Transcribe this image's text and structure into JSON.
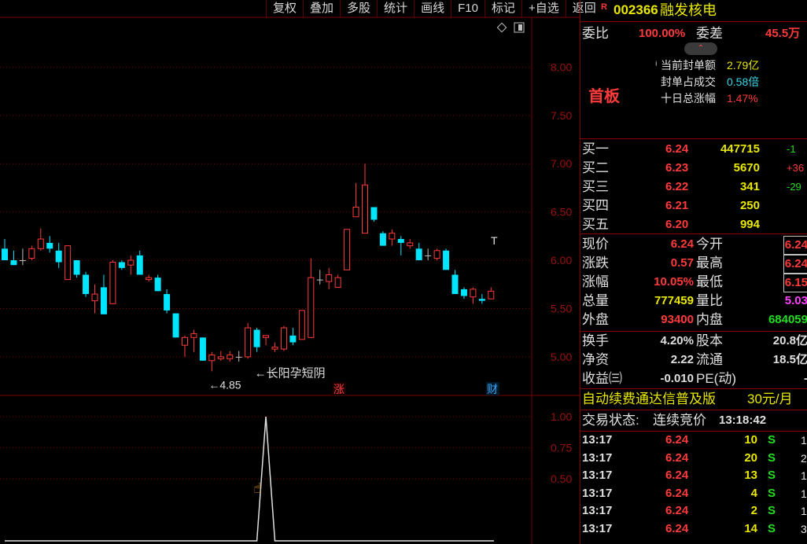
{
  "toolbar": [
    "复权",
    "叠加",
    "多股",
    "统计",
    "画线",
    "F10",
    "标记",
    "+自选",
    "返回"
  ],
  "chart": {
    "price_ticks": [
      "8.00",
      "7.50",
      "7.00",
      "6.50",
      "6.00",
      "5.50",
      "5.00"
    ],
    "indicator_ticks": [
      "1.00",
      "0.75",
      "0.50"
    ],
    "low_label": "←4.85",
    "pattern_label": "←长阳孕短阴",
    "t_marker": "T",
    "zhang_badge": "涨",
    "cai_badge": "财",
    "colors": {
      "up": "#ff3a3a",
      "down": "#00e5ff",
      "doji": "#c0c0c0",
      "grid": "#7a0000"
    }
  },
  "chart_data": {
    "type": "candlestick",
    "price_axis": {
      "min": 4.6,
      "max": 8.5,
      "ticks": [
        8.0,
        7.5,
        7.0,
        6.5,
        6.0,
        5.5,
        5.0
      ]
    },
    "indicator_axis": {
      "min": 0,
      "max": 1.0,
      "ticks": [
        1.0,
        0.75,
        0.5
      ]
    },
    "candles": [
      {
        "o": 6.12,
        "h": 6.22,
        "l": 6.0,
        "c": 6.0
      },
      {
        "o": 6.0,
        "h": 6.1,
        "l": 5.95,
        "c": 5.95
      },
      {
        "o": 6.0,
        "h": 6.12,
        "l": 5.95,
        "c": 6.0
      },
      {
        "o": 6.02,
        "h": 6.15,
        "l": 6.0,
        "c": 6.12
      },
      {
        "o": 6.12,
        "h": 6.33,
        "l": 6.1,
        "c": 6.22
      },
      {
        "o": 6.18,
        "h": 6.25,
        "l": 6.08,
        "c": 6.12
      },
      {
        "o": 6.1,
        "h": 6.18,
        "l": 5.92,
        "c": 5.98
      },
      {
        "o": 5.8,
        "h": 6.1,
        "l": 5.8,
        "c": 6.15
      },
      {
        "o": 6.0,
        "h": 6.0,
        "l": 5.82,
        "c": 5.85
      },
      {
        "o": 5.85,
        "h": 5.88,
        "l": 5.62,
        "c": 5.65
      },
      {
        "o": 5.58,
        "h": 5.75,
        "l": 5.45,
        "c": 5.65
      },
      {
        "o": 5.72,
        "h": 5.85,
        "l": 5.44,
        "c": 5.44
      },
      {
        "o": 5.55,
        "h": 6.0,
        "l": 5.55,
        "c": 5.98
      },
      {
        "o": 5.98,
        "h": 6.0,
        "l": 5.9,
        "c": 5.92
      },
      {
        "o": 5.95,
        "h": 6.05,
        "l": 5.85,
        "c": 6.0
      },
      {
        "o": 6.05,
        "h": 6.1,
        "l": 5.85,
        "c": 5.85
      },
      {
        "o": 5.8,
        "h": 5.85,
        "l": 5.78,
        "c": 5.82
      },
      {
        "o": 5.82,
        "h": 5.85,
        "l": 5.68,
        "c": 5.68
      },
      {
        "o": 5.65,
        "h": 5.7,
        "l": 5.45,
        "c": 5.48
      },
      {
        "o": 5.45,
        "h": 5.45,
        "l": 5.2,
        "c": 5.2
      },
      {
        "o": 5.12,
        "h": 5.22,
        "l": 5.0,
        "c": 5.2
      },
      {
        "o": 5.2,
        "h": 5.28,
        "l": 5.05,
        "c": 5.24
      },
      {
        "o": 5.2,
        "h": 5.2,
        "l": 4.96,
        "c": 4.96
      },
      {
        "o": 4.96,
        "h": 5.05,
        "l": 4.85,
        "c": 5.02
      },
      {
        "o": 4.98,
        "h": 5.06,
        "l": 4.96,
        "c": 5.0
      },
      {
        "o": 4.98,
        "h": 5.06,
        "l": 4.95,
        "c": 5.02
      },
      {
        "o": 5.0,
        "h": 5.06,
        "l": 4.95,
        "c": 5.0
      },
      {
        "o": 5.0,
        "h": 5.35,
        "l": 4.98,
        "c": 5.3
      },
      {
        "o": 5.28,
        "h": 5.3,
        "l": 5.05,
        "c": 5.1
      },
      {
        "o": 5.2,
        "h": 5.22,
        "l": 5.12,
        "c": 5.22
      },
      {
        "o": 5.08,
        "h": 5.15,
        "l": 5.05,
        "c": 5.1
      },
      {
        "o": 5.08,
        "h": 5.32,
        "l": 5.06,
        "c": 5.3
      },
      {
        "o": 5.22,
        "h": 5.3,
        "l": 5.12,
        "c": 5.15
      },
      {
        "o": 5.18,
        "h": 5.48,
        "l": 5.18,
        "c": 5.48
      },
      {
        "o": 5.2,
        "h": 6.02,
        "l": 5.2,
        "c": 5.82
      },
      {
        "o": 5.8,
        "h": 5.9,
        "l": 5.75,
        "c": 5.8
      },
      {
        "o": 5.78,
        "h": 5.92,
        "l": 5.7,
        "c": 5.85
      },
      {
        "o": 5.72,
        "h": 5.85,
        "l": 5.72,
        "c": 5.82
      },
      {
        "o": 5.9,
        "h": 6.32,
        "l": 5.9,
        "c": 6.32
      },
      {
        "o": 6.45,
        "h": 6.8,
        "l": 6.45,
        "c": 6.55
      },
      {
        "o": 6.28,
        "h": 7.0,
        "l": 6.28,
        "c": 6.78
      },
      {
        "o": 6.55,
        "h": 6.55,
        "l": 6.4,
        "c": 6.42
      },
      {
        "o": 6.28,
        "h": 6.3,
        "l": 6.15,
        "c": 6.15
      },
      {
        "o": 6.22,
        "h": 6.32,
        "l": 6.15,
        "c": 6.28
      },
      {
        "o": 6.22,
        "h": 6.25,
        "l": 6.05,
        "c": 6.18
      },
      {
        "o": 6.15,
        "h": 6.22,
        "l": 6.12,
        "c": 6.18
      },
      {
        "o": 6.12,
        "h": 6.18,
        "l": 6.0,
        "c": 6.0
      },
      {
        "o": 6.05,
        "h": 6.12,
        "l": 6.0,
        "c": 6.05
      },
      {
        "o": 6.02,
        "h": 6.12,
        "l": 6.0,
        "c": 6.1
      },
      {
        "o": 6.1,
        "h": 6.12,
        "l": 5.9,
        "c": 5.9
      },
      {
        "o": 5.85,
        "h": 5.9,
        "l": 5.65,
        "c": 5.65
      },
      {
        "o": 5.7,
        "h": 5.72,
        "l": 5.6,
        "c": 5.63
      },
      {
        "o": 5.62,
        "h": 5.72,
        "l": 5.55,
        "c": 5.7
      },
      {
        "o": 5.6,
        "h": 5.65,
        "l": 5.55,
        "c": 5.58
      },
      {
        "o": 5.6,
        "h": 5.72,
        "l": 5.6,
        "c": 5.68
      }
    ],
    "indicator": [
      0,
      0,
      0,
      0,
      0,
      0,
      0,
      0,
      0,
      0,
      0,
      0,
      0,
      0,
      0,
      0,
      0,
      0,
      0,
      0,
      0,
      0,
      0,
      0,
      0,
      0,
      0,
      0,
      0,
      1,
      0,
      0,
      0,
      0,
      0,
      0,
      0,
      0,
      0,
      0,
      0,
      0,
      0,
      0,
      0,
      0,
      0,
      0,
      0,
      0,
      0,
      0,
      0,
      0,
      0
    ]
  },
  "quote": {
    "flag": "R",
    "code": "002366",
    "name": "融发核电",
    "weibi_label": "委比",
    "weibi_value": "100.00%",
    "weicha_label": "委差",
    "weicha_value": "45.5万",
    "first_board": "首板",
    "seal_amount_label": "当前封单额",
    "seal_amount_value": "2.79亿",
    "seal_ratio_label": "封单占成交",
    "seal_ratio_value": "0.58倍",
    "ten_day_label": "十日总涨幅",
    "ten_day_value": "1.47%",
    "bids": [
      {
        "label": "买一",
        "price": "6.24",
        "vol": "447715",
        "chg": "-1"
      },
      {
        "label": "买二",
        "price": "6.23",
        "vol": "5670",
        "chg": "+36"
      },
      {
        "label": "买三",
        "price": "6.22",
        "vol": "341",
        "chg": "-29"
      },
      {
        "label": "买四",
        "price": "6.21",
        "vol": "250",
        "chg": ""
      },
      {
        "label": "买五",
        "price": "6.20",
        "vol": "994",
        "chg": ""
      }
    ],
    "stats": [
      {
        "l1": "现价",
        "v1": "6.24",
        "l2": "今开",
        "v2": "6.24"
      },
      {
        "l1": "涨跌",
        "v1": "0.57",
        "l2": "最高",
        "v2": "6.24"
      },
      {
        "l1": "涨幅",
        "v1": "10.05%",
        "l2": "最低",
        "v2": "6.15"
      },
      {
        "l1": "总量",
        "v1": "777459",
        "l2": "量比",
        "v2": "5.03"
      },
      {
        "l1": "外盘",
        "v1": "93400",
        "l2": "内盘",
        "v2": "684059"
      }
    ],
    "stats2": [
      {
        "l1": "换手",
        "v1": "4.20%",
        "l2": "股本",
        "v2": "20.8亿"
      },
      {
        "l1": "净资",
        "v1": "2.22",
        "l2": "流通",
        "v2": "18.5亿"
      },
      {
        "l1": "收益㈢",
        "v1": "-0.010",
        "l2": "PE(动)",
        "v2": "-"
      }
    ],
    "promo_text": "自动续费通达信普及版",
    "promo_price": "30元/月",
    "status_label": "交易状态:",
    "status_value": "连续竞价",
    "status_time": "13:18:42",
    "ticks": [
      {
        "t": "13:17",
        "p": "6.24",
        "v": "10",
        "s": "S",
        "n": "1"
      },
      {
        "t": "13:17",
        "p": "6.24",
        "v": "20",
        "s": "S",
        "n": "2"
      },
      {
        "t": "13:17",
        "p": "6.24",
        "v": "13",
        "s": "S",
        "n": "1"
      },
      {
        "t": "13:17",
        "p": "6.24",
        "v": "4",
        "s": "S",
        "n": "1"
      },
      {
        "t": "13:17",
        "p": "6.24",
        "v": "2",
        "s": "S",
        "n": "1"
      },
      {
        "t": "13:17",
        "p": "6.24",
        "v": "14",
        "s": "S",
        "n": "3"
      }
    ]
  }
}
